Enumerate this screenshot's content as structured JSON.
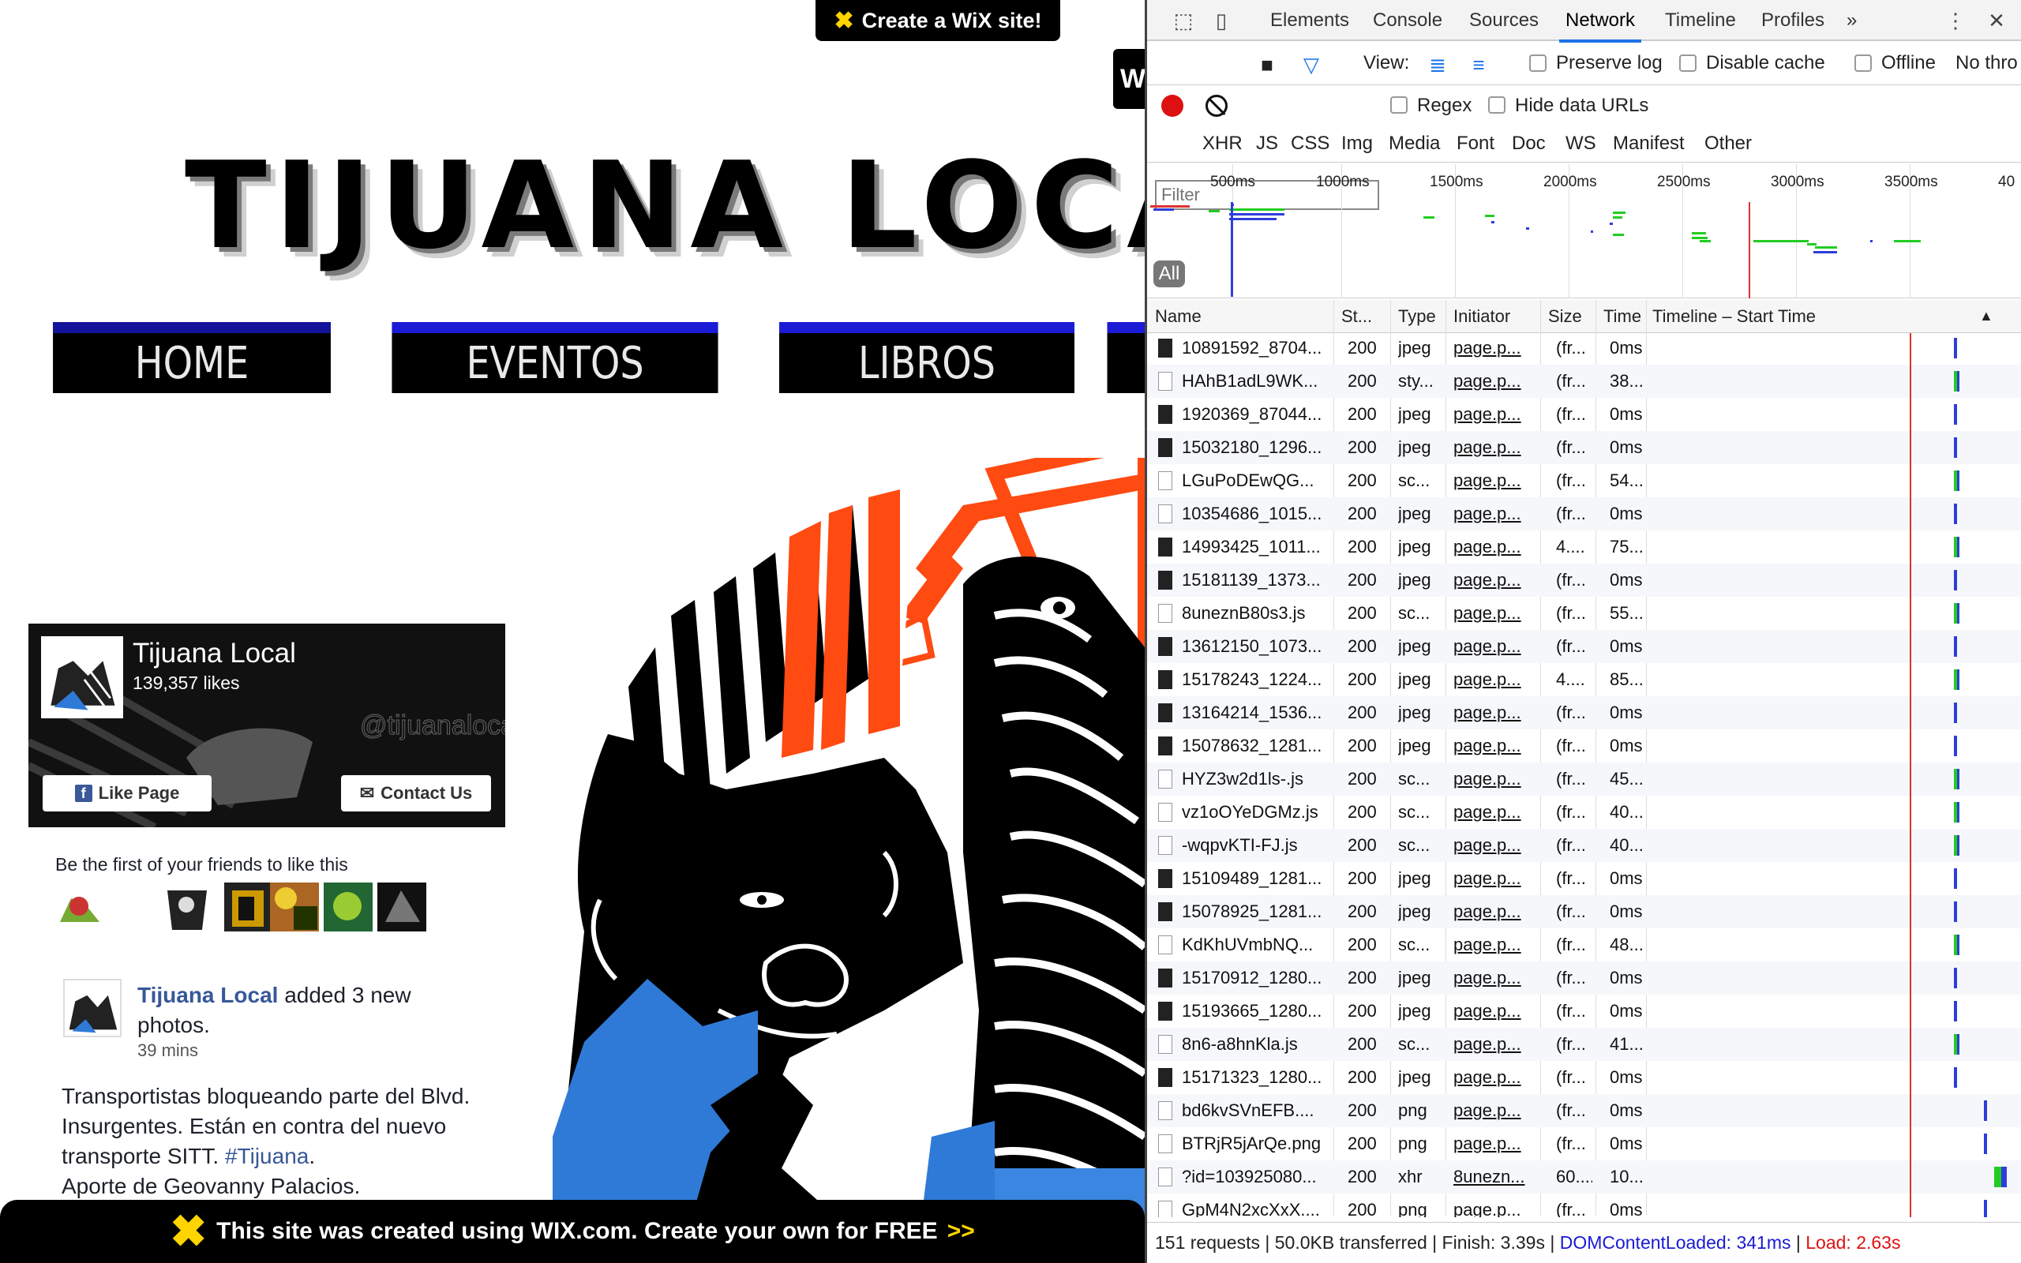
{
  "site": {
    "wix_top_banner": "Create a WiX site!",
    "title": "TIJUANA LOCA",
    "nav": [
      "HOME",
      "EVENTOS",
      "LIBROS"
    ],
    "facebook": {
      "page_name": "Tijuana Local",
      "likes": "139,357 likes",
      "like_button": "Like Page",
      "contact_button": "Contact Us",
      "friends_text": "Be the first of your friends to like this",
      "post_author": "Tijuana Local",
      "post_action": " added 3 new photos.",
      "post_time": "39 mins",
      "post_text_lines": [
        "Transportistas bloqueando parte del Blvd.",
        "Insurgentes. Están en contra del nuevo",
        "transporte SITT. "
      ],
      "post_hashtag": "#Tijuana",
      "post_hashtag_suffix": ".",
      "post_text_last": "Aporte de Geovanny Palacios."
    },
    "wix_bottom_banner": "This site was created using WIX.com. Create your own for FREE",
    "wix_bottom_arrows": ">>"
  },
  "devtools": {
    "tabs": [
      "Elements",
      "Console",
      "Sources",
      "Network",
      "Timeline",
      "Profiles"
    ],
    "more_tabs": "»",
    "toolbar": {
      "view_label": "View:",
      "preserve_log": "Preserve log",
      "disable_cache": "Disable cache",
      "offline": "Offline",
      "throttle": "No thro"
    },
    "filter_placeholder": "Filter",
    "regex": "Regex",
    "hide_data_urls": "Hide data URLs",
    "types": [
      "All",
      "XHR",
      "JS",
      "CSS",
      "Img",
      "Media",
      "Font",
      "Doc",
      "WS",
      "Manifest",
      "Other"
    ],
    "overview_ticks": [
      "500ms",
      "1000ms",
      "1500ms",
      "2000ms",
      "2500ms",
      "3000ms",
      "3500ms",
      "40"
    ],
    "columns": [
      "Name",
      "St...",
      "Type",
      "Initiator",
      "Size",
      "Time",
      "Timeline – Start Time"
    ],
    "sort_arrow": "▲",
    "rows": [
      {
        "name": "10891592_8704...",
        "status": "200",
        "type": "jpeg",
        "initiator": "page.p...",
        "size": "(fr...",
        "time": "0ms",
        "img": true
      },
      {
        "name": "HAhB1adL9WK...",
        "status": "200",
        "type": "sty...",
        "initiator": "page.p...",
        "size": "(fr...",
        "time": "38...",
        "img": false
      },
      {
        "name": "1920369_87044...",
        "status": "200",
        "type": "jpeg",
        "initiator": "page.p...",
        "size": "(fr...",
        "time": "0ms",
        "img": true
      },
      {
        "name": "15032180_1296...",
        "status": "200",
        "type": "jpeg",
        "initiator": "page.p...",
        "size": "(fr...",
        "time": "0ms",
        "img": true
      },
      {
        "name": "LGuPoDEwQG...",
        "status": "200",
        "type": "sc...",
        "initiator": "page.p...",
        "size": "(fr...",
        "time": "54...",
        "img": false
      },
      {
        "name": "10354686_1015...",
        "status": "200",
        "type": "jpeg",
        "initiator": "page.p...",
        "size": "(fr...",
        "time": "0ms",
        "img": false
      },
      {
        "name": "14993425_1011...",
        "status": "200",
        "type": "jpeg",
        "initiator": "page.p...",
        "size": "4....",
        "time": "75...",
        "img": true
      },
      {
        "name": "15181139_1373...",
        "status": "200",
        "type": "jpeg",
        "initiator": "page.p...",
        "size": "(fr...",
        "time": "0ms",
        "img": true
      },
      {
        "name": "8uneznB80s3.js",
        "status": "200",
        "type": "sc...",
        "initiator": "page.p...",
        "size": "(fr...",
        "time": "55...",
        "img": false
      },
      {
        "name": "13612150_1073...",
        "status": "200",
        "type": "jpeg",
        "initiator": "page.p...",
        "size": "(fr...",
        "time": "0ms",
        "img": true
      },
      {
        "name": "15178243_1224...",
        "status": "200",
        "type": "jpeg",
        "initiator": "page.p...",
        "size": "4....",
        "time": "85...",
        "img": true
      },
      {
        "name": "13164214_1536...",
        "status": "200",
        "type": "jpeg",
        "initiator": "page.p...",
        "size": "(fr...",
        "time": "0ms",
        "img": true
      },
      {
        "name": "15078632_1281...",
        "status": "200",
        "type": "jpeg",
        "initiator": "page.p...",
        "size": "(fr...",
        "time": "0ms",
        "img": true
      },
      {
        "name": "HYZ3w2d1ls-.js",
        "status": "200",
        "type": "sc...",
        "initiator": "page.p...",
        "size": "(fr...",
        "time": "45...",
        "img": false
      },
      {
        "name": "vz1oOYeDGMz.js",
        "status": "200",
        "type": "sc...",
        "initiator": "page.p...",
        "size": "(fr...",
        "time": "40...",
        "img": false
      },
      {
        "name": "-wqpvKTI-FJ.js",
        "status": "200",
        "type": "sc...",
        "initiator": "page.p...",
        "size": "(fr...",
        "time": "40...",
        "img": false
      },
      {
        "name": "15109489_1281...",
        "status": "200",
        "type": "jpeg",
        "initiator": "page.p...",
        "size": "(fr...",
        "time": "0ms",
        "img": true
      },
      {
        "name": "15078925_1281...",
        "status": "200",
        "type": "jpeg",
        "initiator": "page.p...",
        "size": "(fr...",
        "time": "0ms",
        "img": true
      },
      {
        "name": "KdKhUVmbNQ...",
        "status": "200",
        "type": "sc...",
        "initiator": "page.p...",
        "size": "(fr...",
        "time": "48...",
        "img": false
      },
      {
        "name": "15170912_1280...",
        "status": "200",
        "type": "jpeg",
        "initiator": "page.p...",
        "size": "(fr...",
        "time": "0ms",
        "img": true
      },
      {
        "name": "15193665_1280...",
        "status": "200",
        "type": "jpeg",
        "initiator": "page.p...",
        "size": "(fr...",
        "time": "0ms",
        "img": true
      },
      {
        "name": "8n6-a8hnKla.js",
        "status": "200",
        "type": "sc...",
        "initiator": "page.p...",
        "size": "(fr...",
        "time": "41...",
        "img": false
      },
      {
        "name": "15171323_1280...",
        "status": "200",
        "type": "jpeg",
        "initiator": "page.p...",
        "size": "(fr...",
        "time": "0ms",
        "img": true
      },
      {
        "name": "bd6kvSVnEFB....",
        "status": "200",
        "type": "png",
        "initiator": "page.p...",
        "size": "(fr...",
        "time": "0ms",
        "img": false
      },
      {
        "name": "BTRjR5jArQe.png",
        "status": "200",
        "type": "png",
        "initiator": "page.p...",
        "size": "(fr...",
        "time": "0ms",
        "img": false
      },
      {
        "name": "?id=103925080...",
        "status": "200",
        "type": "xhr",
        "initiator": "8unezn...",
        "size": "60....",
        "time": "10...",
        "img": false
      },
      {
        "name": "GpM4N2xcXxX....",
        "status": "200",
        "type": "png",
        "initiator": "page.p...",
        "size": "(fr...",
        "time": "0ms",
        "img": false
      }
    ],
    "status_bar": {
      "summary": "151 requests | 50.0KB transferred | Finish: 3.39s | ",
      "dom_content_loaded": "DOMContentLoaded: 341ms",
      "separator": " | ",
      "load": "Load: 2.63s"
    }
  }
}
